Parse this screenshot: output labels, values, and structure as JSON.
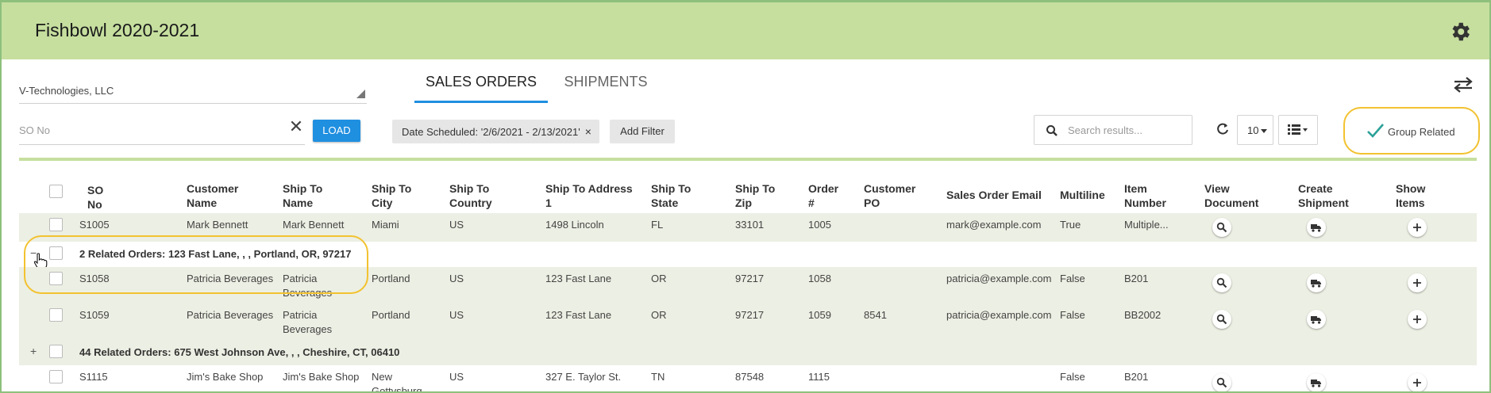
{
  "app": {
    "title": "Fishbowl 2020-2021"
  },
  "left": {
    "company": "V-Technologies, LLC",
    "so_placeholder": "SO No",
    "load_label": "LOAD"
  },
  "tabs": [
    {
      "label": "SALES ORDERS",
      "active": true
    },
    {
      "label": "SHIPMENTS",
      "active": false
    }
  ],
  "filters": {
    "date_chip": "Date Scheduled: '2/6/2021 - 2/13/2021'",
    "chip_close": "×",
    "add_filter": "Add Filter"
  },
  "toolbar": {
    "search_placeholder": "Search results...",
    "per_page": "10",
    "group_related": "Group Related"
  },
  "columns": [
    "SO No",
    "Customer Name",
    "Ship To Name",
    "Ship To City",
    "Ship To Country",
    "Ship To Address 1",
    "Ship To State",
    "Ship To Zip",
    "Order #",
    "Customer PO",
    "Sales Order Email",
    "Multiline",
    "Item Number",
    "View Document",
    "Create Shipment",
    "Show Items"
  ],
  "header_lines": {
    "so": [
      "SO",
      "No"
    ],
    "customer": [
      "Customer",
      "Name"
    ],
    "shipto_name": [
      "Ship To",
      "Name"
    ],
    "city": [
      "Ship To",
      "City"
    ],
    "country": [
      "Ship To",
      "Country"
    ],
    "address": [
      "Ship To Address",
      "1"
    ],
    "state": [
      "Ship To",
      "State"
    ],
    "zip": [
      "Ship To",
      "Zip"
    ],
    "order": [
      "Order",
      "#"
    ],
    "po": [
      "Customer",
      "PO"
    ],
    "email": [
      "Sales Order Email"
    ],
    "multiline": [
      "Multiline"
    ],
    "item": [
      "Item",
      "Number"
    ],
    "view": [
      "View",
      "Document"
    ],
    "create": [
      "Create",
      "Shipment"
    ],
    "show": [
      "Show",
      "Items"
    ]
  },
  "rows": {
    "r1": {
      "so": "S1005",
      "customer": "Mark Bennett",
      "shipto_name": "Mark Bennett",
      "city": "Miami",
      "country": "US",
      "address": "1498 Lincoln",
      "state": "FL",
      "zip": "33101",
      "order": "1005",
      "po": "",
      "email": "mark@example.com",
      "multiline": "True",
      "item": "Multiple..."
    },
    "g1": {
      "expander": "−",
      "label": "2 Related Orders: 123 Fast Lane, , , Portland, OR, 97217"
    },
    "r2": {
      "so": "S1058",
      "customer": "Patricia Beverages",
      "shipto_name_1": "Patricia",
      "shipto_name_2": "Beverages",
      "city": "Portland",
      "country": "US",
      "address": "123 Fast Lane",
      "state": "OR",
      "zip": "97217",
      "order": "1058",
      "po": "",
      "email": "patricia@example.com",
      "multiline": "False",
      "item": "B201"
    },
    "r3": {
      "so": "S1059",
      "customer": "Patricia Beverages",
      "shipto_name_1": "Patricia",
      "shipto_name_2": "Beverages",
      "city": "Portland",
      "country": "US",
      "address": "123 Fast Lane",
      "state": "OR",
      "zip": "97217",
      "order": "1059",
      "po": "8541",
      "email": "patricia@example.com",
      "multiline": "False",
      "item": "BB2002"
    },
    "g2": {
      "expander": "+",
      "label": "44 Related Orders: 675 West Johnson Ave, , , Cheshire, CT, 06410"
    },
    "r4": {
      "so": "S1115",
      "customer": "Jim's Bake Shop",
      "shipto_name": "Jim's Bake Shop",
      "city_1": "New",
      "city_2": "Gottysburg",
      "country": "US",
      "address": "327 E. Taylor St.",
      "state": "TN",
      "zip": "87548",
      "order": "1115",
      "po": "",
      "email": "",
      "multiline": "False",
      "item": "B201"
    }
  },
  "icons": {
    "settings": "gear-icon",
    "swap": "swap-arrows-icon",
    "search": "search-icon",
    "refresh": "refresh-icon",
    "view": "list-view-icon",
    "check": "check-icon",
    "view_document": "magnifier-icon",
    "create_shipment": "truck-icon",
    "show_items": "plus-icon"
  },
  "colors": {
    "header_bg": "#c6df9f",
    "accent_blue": "#1f8fe0",
    "highlight": "#f2c230",
    "check_teal": "#2aa198",
    "row_alt": "#ecefe3"
  }
}
